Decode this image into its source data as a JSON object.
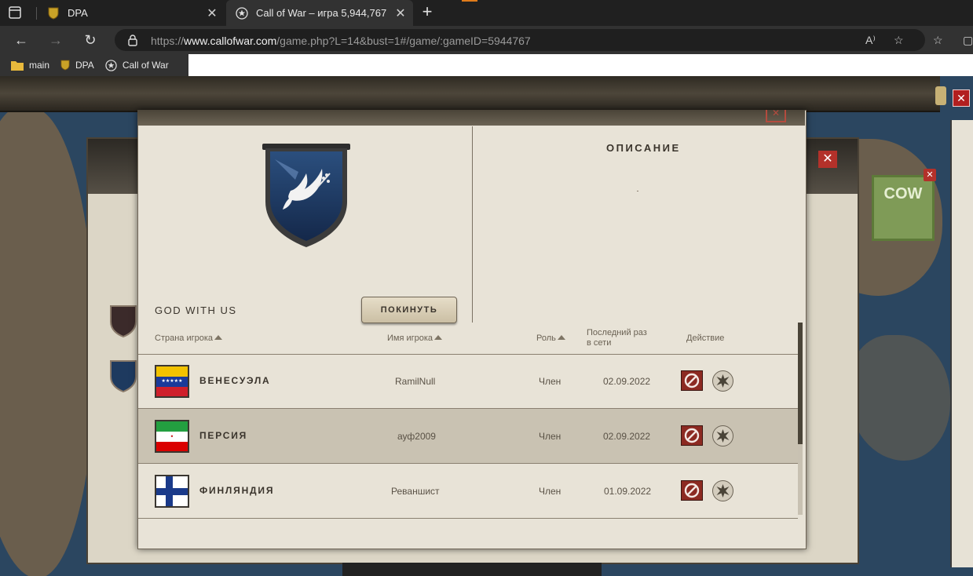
{
  "browser": {
    "tabs": [
      {
        "title": "DPA",
        "icon": "dpa-shield-icon"
      },
      {
        "title": "Call of War – игра 5,944,767",
        "icon": "star-circle-icon",
        "active": true
      }
    ],
    "new_tab_glyph": "+",
    "url": {
      "scheme": "https://",
      "host": "www.callofwar.com",
      "path": "/game.php?L=14&bust=1#/game/:gameID=5944767"
    },
    "bookmarks": [
      {
        "label": "main",
        "icon": "folder-icon"
      },
      {
        "label": "DPA",
        "icon": "dpa-shield-icon"
      },
      {
        "label": "Call of War",
        "icon": "star-circle-icon"
      }
    ]
  },
  "game": {
    "behind_window_char": "✕",
    "cow_badge": "COW"
  },
  "modal": {
    "coalition_name": "GOD WITH US",
    "leave_button": "ПОКИНУТЬ",
    "description_title": "ОПИСАНИЕ",
    "description_text": "",
    "columns": {
      "country": "Страна игрока",
      "player": "Имя игрока",
      "role": "Роль",
      "last_online_line1": "Последний раз",
      "last_online_line2": "в сети",
      "action": "Действие"
    },
    "members": [
      {
        "country": "ВЕНЕСУЭЛА",
        "player": "RamilNull",
        "role": "Член",
        "last_online": "02.09.2022",
        "flag": "venezuela"
      },
      {
        "country": "ПЕРСИЯ",
        "player": "ауф2009",
        "role": "Член",
        "last_online": "02.09.2022",
        "flag": "persia",
        "selected": true
      },
      {
        "country": "ФИНЛЯНДИЯ",
        "player": "Реваншист",
        "role": "Член",
        "last_online": "01.09.2022",
        "flag": "finland"
      }
    ]
  },
  "colors": {
    "modal_bg": "#e8e3d7",
    "kick_button": "#8c2a22",
    "selected_row": "#c9c2b2",
    "crest_blue": "#1e3a5f"
  }
}
